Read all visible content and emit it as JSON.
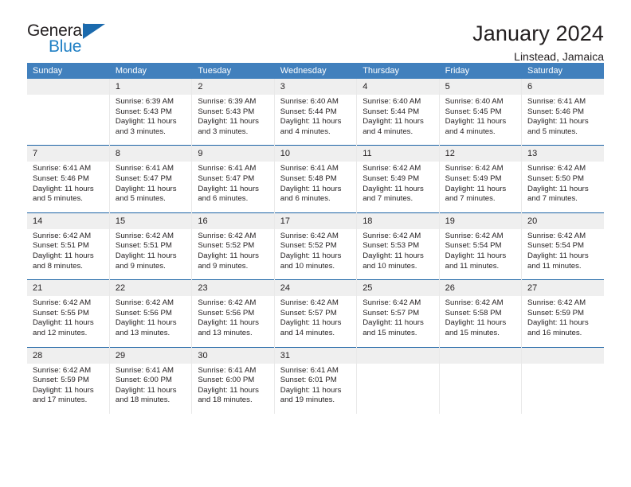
{
  "brand": {
    "word_one": "General",
    "word_two": "Blue",
    "accent_color": "#1f7fc4",
    "triangle_color": "#1b6aad",
    "logo_icon": "triangle-icon"
  },
  "header": {
    "title": "January 2024",
    "subtitle": "Linstead, Jamaica"
  },
  "theme": {
    "header_blue": "#4180bd",
    "week_divider_blue": "#1b63a5",
    "daynum_band": "#efefef",
    "text": "#231f20"
  },
  "columns": [
    "Sunday",
    "Monday",
    "Tuesday",
    "Wednesday",
    "Thursday",
    "Friday",
    "Saturday"
  ],
  "labels": {
    "sunrise": "Sunrise:",
    "sunset": "Sunset:",
    "daylight": "Daylight:"
  },
  "weeks": [
    [
      {
        "day": "",
        "sunrise": "",
        "sunset": "",
        "daylight_line1": "",
        "daylight_line2": ""
      },
      {
        "day": "1",
        "sunrise": "Sunrise: 6:39 AM",
        "sunset": "Sunset: 5:43 PM",
        "daylight_line1": "Daylight: 11 hours",
        "daylight_line2": "and 3 minutes."
      },
      {
        "day": "2",
        "sunrise": "Sunrise: 6:39 AM",
        "sunset": "Sunset: 5:43 PM",
        "daylight_line1": "Daylight: 11 hours",
        "daylight_line2": "and 3 minutes."
      },
      {
        "day": "3",
        "sunrise": "Sunrise: 6:40 AM",
        "sunset": "Sunset: 5:44 PM",
        "daylight_line1": "Daylight: 11 hours",
        "daylight_line2": "and 4 minutes."
      },
      {
        "day": "4",
        "sunrise": "Sunrise: 6:40 AM",
        "sunset": "Sunset: 5:44 PM",
        "daylight_line1": "Daylight: 11 hours",
        "daylight_line2": "and 4 minutes."
      },
      {
        "day": "5",
        "sunrise": "Sunrise: 6:40 AM",
        "sunset": "Sunset: 5:45 PM",
        "daylight_line1": "Daylight: 11 hours",
        "daylight_line2": "and 4 minutes."
      },
      {
        "day": "6",
        "sunrise": "Sunrise: 6:41 AM",
        "sunset": "Sunset: 5:46 PM",
        "daylight_line1": "Daylight: 11 hours",
        "daylight_line2": "and 5 minutes."
      }
    ],
    [
      {
        "day": "7",
        "sunrise": "Sunrise: 6:41 AM",
        "sunset": "Sunset: 5:46 PM",
        "daylight_line1": "Daylight: 11 hours",
        "daylight_line2": "and 5 minutes."
      },
      {
        "day": "8",
        "sunrise": "Sunrise: 6:41 AM",
        "sunset": "Sunset: 5:47 PM",
        "daylight_line1": "Daylight: 11 hours",
        "daylight_line2": "and 5 minutes."
      },
      {
        "day": "9",
        "sunrise": "Sunrise: 6:41 AM",
        "sunset": "Sunset: 5:47 PM",
        "daylight_line1": "Daylight: 11 hours",
        "daylight_line2": "and 6 minutes."
      },
      {
        "day": "10",
        "sunrise": "Sunrise: 6:41 AM",
        "sunset": "Sunset: 5:48 PM",
        "daylight_line1": "Daylight: 11 hours",
        "daylight_line2": "and 6 minutes."
      },
      {
        "day": "11",
        "sunrise": "Sunrise: 6:42 AM",
        "sunset": "Sunset: 5:49 PM",
        "daylight_line1": "Daylight: 11 hours",
        "daylight_line2": "and 7 minutes."
      },
      {
        "day": "12",
        "sunrise": "Sunrise: 6:42 AM",
        "sunset": "Sunset: 5:49 PM",
        "daylight_line1": "Daylight: 11 hours",
        "daylight_line2": "and 7 minutes."
      },
      {
        "day": "13",
        "sunrise": "Sunrise: 6:42 AM",
        "sunset": "Sunset: 5:50 PM",
        "daylight_line1": "Daylight: 11 hours",
        "daylight_line2": "and 7 minutes."
      }
    ],
    [
      {
        "day": "14",
        "sunrise": "Sunrise: 6:42 AM",
        "sunset": "Sunset: 5:51 PM",
        "daylight_line1": "Daylight: 11 hours",
        "daylight_line2": "and 8 minutes."
      },
      {
        "day": "15",
        "sunrise": "Sunrise: 6:42 AM",
        "sunset": "Sunset: 5:51 PM",
        "daylight_line1": "Daylight: 11 hours",
        "daylight_line2": "and 9 minutes."
      },
      {
        "day": "16",
        "sunrise": "Sunrise: 6:42 AM",
        "sunset": "Sunset: 5:52 PM",
        "daylight_line1": "Daylight: 11 hours",
        "daylight_line2": "and 9 minutes."
      },
      {
        "day": "17",
        "sunrise": "Sunrise: 6:42 AM",
        "sunset": "Sunset: 5:52 PM",
        "daylight_line1": "Daylight: 11 hours",
        "daylight_line2": "and 10 minutes."
      },
      {
        "day": "18",
        "sunrise": "Sunrise: 6:42 AM",
        "sunset": "Sunset: 5:53 PM",
        "daylight_line1": "Daylight: 11 hours",
        "daylight_line2": "and 10 minutes."
      },
      {
        "day": "19",
        "sunrise": "Sunrise: 6:42 AM",
        "sunset": "Sunset: 5:54 PM",
        "daylight_line1": "Daylight: 11 hours",
        "daylight_line2": "and 11 minutes."
      },
      {
        "day": "20",
        "sunrise": "Sunrise: 6:42 AM",
        "sunset": "Sunset: 5:54 PM",
        "daylight_line1": "Daylight: 11 hours",
        "daylight_line2": "and 11 minutes."
      }
    ],
    [
      {
        "day": "21",
        "sunrise": "Sunrise: 6:42 AM",
        "sunset": "Sunset: 5:55 PM",
        "daylight_line1": "Daylight: 11 hours",
        "daylight_line2": "and 12 minutes."
      },
      {
        "day": "22",
        "sunrise": "Sunrise: 6:42 AM",
        "sunset": "Sunset: 5:56 PM",
        "daylight_line1": "Daylight: 11 hours",
        "daylight_line2": "and 13 minutes."
      },
      {
        "day": "23",
        "sunrise": "Sunrise: 6:42 AM",
        "sunset": "Sunset: 5:56 PM",
        "daylight_line1": "Daylight: 11 hours",
        "daylight_line2": "and 13 minutes."
      },
      {
        "day": "24",
        "sunrise": "Sunrise: 6:42 AM",
        "sunset": "Sunset: 5:57 PM",
        "daylight_line1": "Daylight: 11 hours",
        "daylight_line2": "and 14 minutes."
      },
      {
        "day": "25",
        "sunrise": "Sunrise: 6:42 AM",
        "sunset": "Sunset: 5:57 PM",
        "daylight_line1": "Daylight: 11 hours",
        "daylight_line2": "and 15 minutes."
      },
      {
        "day": "26",
        "sunrise": "Sunrise: 6:42 AM",
        "sunset": "Sunset: 5:58 PM",
        "daylight_line1": "Daylight: 11 hours",
        "daylight_line2": "and 15 minutes."
      },
      {
        "day": "27",
        "sunrise": "Sunrise: 6:42 AM",
        "sunset": "Sunset: 5:59 PM",
        "daylight_line1": "Daylight: 11 hours",
        "daylight_line2": "and 16 minutes."
      }
    ],
    [
      {
        "day": "28",
        "sunrise": "Sunrise: 6:42 AM",
        "sunset": "Sunset: 5:59 PM",
        "daylight_line1": "Daylight: 11 hours",
        "daylight_line2": "and 17 minutes."
      },
      {
        "day": "29",
        "sunrise": "Sunrise: 6:41 AM",
        "sunset": "Sunset: 6:00 PM",
        "daylight_line1": "Daylight: 11 hours",
        "daylight_line2": "and 18 minutes."
      },
      {
        "day": "30",
        "sunrise": "Sunrise: 6:41 AM",
        "sunset": "Sunset: 6:00 PM",
        "daylight_line1": "Daylight: 11 hours",
        "daylight_line2": "and 18 minutes."
      },
      {
        "day": "31",
        "sunrise": "Sunrise: 6:41 AM",
        "sunset": "Sunset: 6:01 PM",
        "daylight_line1": "Daylight: 11 hours",
        "daylight_line2": "and 19 minutes."
      },
      {
        "day": "",
        "sunrise": "",
        "sunset": "",
        "daylight_line1": "",
        "daylight_line2": ""
      },
      {
        "day": "",
        "sunrise": "",
        "sunset": "",
        "daylight_line1": "",
        "daylight_line2": ""
      },
      {
        "day": "",
        "sunrise": "",
        "sunset": "",
        "daylight_line1": "",
        "daylight_line2": ""
      }
    ]
  ]
}
